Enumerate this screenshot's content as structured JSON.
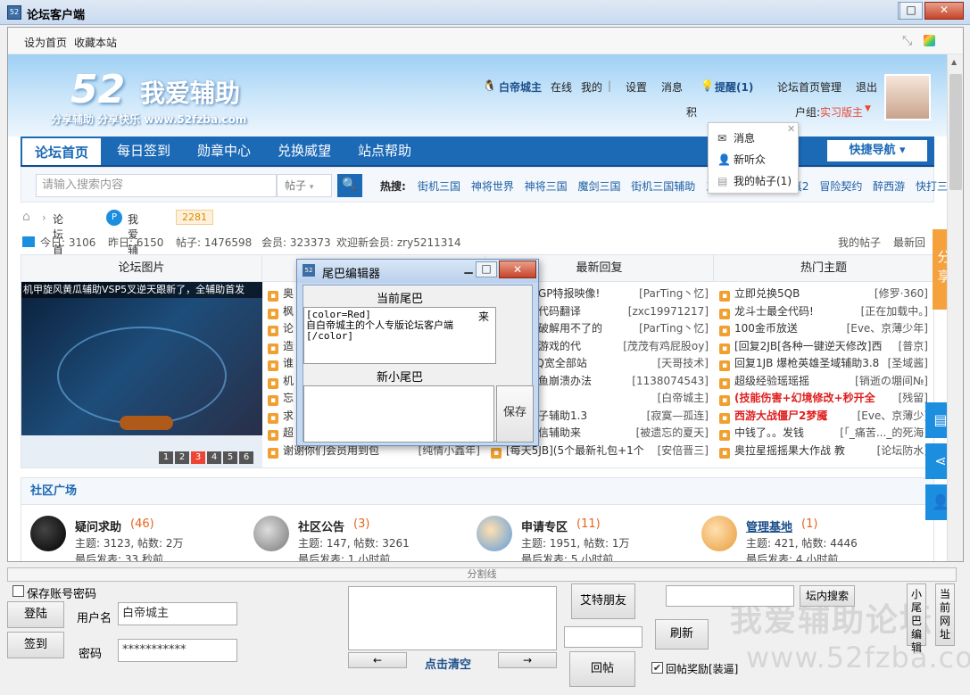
{
  "window": {
    "title": "论坛客户端"
  },
  "browser_top": {
    "set_home": "设为首页",
    "bookmark": "收藏本站"
  },
  "header": {
    "logo_num": "52",
    "logo_text": "我爱辅助",
    "logo_sub": "分享辅助  分享快乐  www.52fzba.com",
    "username": "白帝城主",
    "status": "在线",
    "mine": "我的",
    "settings": "设置",
    "messages": "消息",
    "remind": "提醒(1)",
    "manage": "论坛首页管理",
    "logout": "退出",
    "integral": "积",
    "group_label": "户组:",
    "group_value": "实习版主"
  },
  "dropdown": {
    "items": [
      "消息",
      "新听众",
      "我的帖子(1)"
    ]
  },
  "nav": {
    "items": [
      "论坛首页",
      "每日签到",
      "勋章中心",
      "兑换威望",
      "站点帮助"
    ],
    "quick": "快捷导航"
  },
  "search": {
    "placeholder": "请输入搜索内容",
    "type": "帖子",
    "hot_label": "热搜:",
    "hot": "街机三国 神将世界 神将三国 魔剑三国 街机三国辅助 三国快打 凡人修真2 冒险契约 醉西游 快打三国"
  },
  "breadcrumb": {
    "home": "论坛首页",
    "site": "我爱辅助",
    "count": "2281"
  },
  "stats": {
    "today": "今日: 3106",
    "yesterday": "昨日: 6150",
    "posts": "帖子: 1476598",
    "members": "会员: 323373",
    "welcome": "欢迎新会员: zry5211314",
    "my_posts": "我的帖子",
    "latest": "最新回"
  },
  "columns": {
    "headers": [
      "论坛图片",
      "",
      "最新回复",
      "热门主题"
    ],
    "pic_caption": "机甲旋风黄瓜辅助VSP5叉逆天跟新了，全辅助首发",
    "pic_nums": [
      "1",
      "2",
      "3",
      "4",
      "5",
      "6"
    ],
    "col2": [
      {
        "t": "奥"
      },
      {
        "t": "枫"
      },
      {
        "t": "论"
      },
      {
        "t": "造"
      },
      {
        "t": "谁"
      },
      {
        "t": "机"
      },
      {
        "t": "忘"
      },
      {
        "t": "求"
      },
      {
        "t": "超"
      },
      {
        "t": "谢谢你们会员用到包",
        "w": "[纯情小鑫年]"
      }
    ],
    "col3": [
      {
        "t": "雄大战GP特报映像!",
        "w": "[ParTing丶忆]"
      },
      {
        "t": "胡人物代码翻译",
        "w": "[zxc19971217]"
      },
      {
        "t": "些幸运破解用不了的",
        "w": "[ParTing丶忆]"
      },
      {
        "t": "设这个游戏的代",
        "w": "[茂茂有鸡屁股oy]"
      },
      {
        "t": "件】QQ宽全部站",
        "w": "[天哥技术]"
      },
      {
        "t": "的百鳄鱼崩溃办法",
        "w": "[1138074543]"
      },
      {
        "t": "",
        "w": "[白帝城主]"
      },
      {
        "t": "机甲小子辅助1.3",
        "w": "[寂寞—孤连]"
      },
      {
        "t": "被老鼠信辅助来",
        "w": "[被遗忘的夏天]"
      },
      {
        "t": "[每天5JB](5个最新礼包+1个",
        "w": "[安倍晋三]"
      }
    ],
    "col4": [
      {
        "t": "立即兑换5QB",
        "w": "[修罗·360]"
      },
      {
        "t": "龙斗士最全代码!",
        "w": "[正在加载中。]"
      },
      {
        "t": "100金币放送",
        "w": "[Eve、京薄少年]"
      },
      {
        "t": "[回复2JB[各种一键逆天修改]西",
        "w": "[普京]"
      },
      {
        "t": "回复1JB 爆枪英雄圣域辅助3.8",
        "w": "[圣域酱]"
      },
      {
        "t": "超级经验瑶瑶摇",
        "w": "[销逝の堋间№]"
      },
      {
        "t": "(技能伤害+幻境修改+秒开全",
        "w": "[残留]",
        "red": true
      },
      {
        "t": "西游大战僵尸2梦魇",
        "w": "[Eve、京薄少]",
        "red": true
      },
      {
        "t": "中钱了。。发钱",
        "w": "[「_痛苦..._的死海]"
      },
      {
        "t": "奥拉星摇摇果大作战 教",
        "w": "[论坛防水]"
      }
    ]
  },
  "community": {
    "title": "社区广场",
    "forums": [
      {
        "name": "疑问求助",
        "count": "(46)",
        "line1": "主题: 3123, 帖数: 2万",
        "line2": "最后发表: 33 秒前"
      },
      {
        "name": "社区公告",
        "count": "(3)",
        "line1": "主题: 147, 帖数: 3261",
        "line2": "最后发表: 1 小时前"
      },
      {
        "name": "申请专区",
        "count": "(11)",
        "line1": "主题: 1951, 帖数: 1万",
        "line2": "最后发表: 5 小时前"
      },
      {
        "name": "管理基地",
        "count": "(1)",
        "line1": "主题: 421, 帖数: 4446",
        "line2": "最后发表: 4 小时前"
      }
    ]
  },
  "side": {
    "share": "分享"
  },
  "dialog": {
    "title": "尾巴编辑器",
    "current_label": "当前尾巴",
    "current_text": "[color=Red]\n自白帝城主的个人专版论坛客户端\n[/color]",
    "current_suffix": "来",
    "new_label": "新小尾巴",
    "save": "保存"
  },
  "bottom": {
    "divider": "分割线",
    "remember": "保存账号密码",
    "login": "登陆",
    "signin": "签到",
    "user_label": "用户名",
    "user_value": "白帝城主",
    "pwd_label": "密码",
    "pwd_value": "***********",
    "prev": "←",
    "next": "→",
    "clear": "点击清空",
    "at_friend": "艾特朋友",
    "reply": "回帖",
    "refresh": "刷新",
    "site_search": "坛内搜索",
    "reward": "回帖奖励[装逼]",
    "tail_edit": "小尾巴编辑",
    "cur_url": "当前网址",
    "watermark": "我爱辅助论坛",
    "watermark_url": "www.52fzba.com"
  }
}
